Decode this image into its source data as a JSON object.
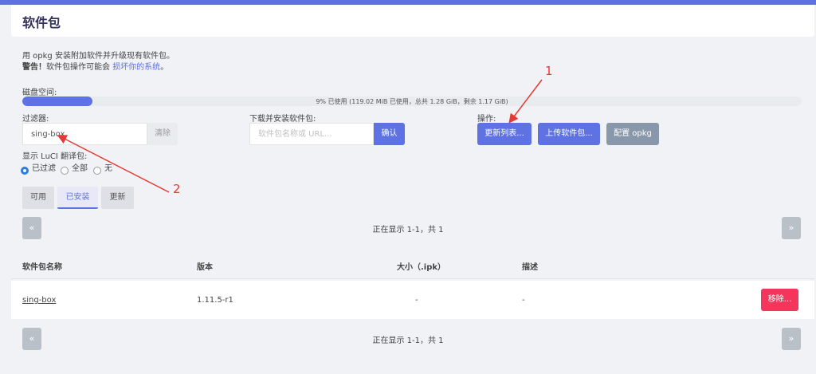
{
  "page": {
    "title": "软件包",
    "intro": "用 opkg 安装附加软件并升级现有软件包。",
    "warning_prefix": "警告！",
    "warning_text": "软件包操作可能会",
    "warning_link": "损坏你的系统",
    "warning_suffix": "。"
  },
  "disk": {
    "label": "磁盘空间:",
    "used_fraction": 0.09,
    "status_text": "9% 已使用 (119.02 MiB 已使用，总共 1.28 GiB，剩余 1.17 GiB)"
  },
  "filter": {
    "label": "过滤器:",
    "value": "sing-box",
    "clear_label": "清除"
  },
  "download": {
    "label": "下载并安装软件包:",
    "placeholder": "软件包名称或 URL...",
    "confirm_label": "确认"
  },
  "actions": {
    "label": "操作:",
    "update_label": "更新列表...",
    "upload_label": "上传软件包...",
    "config_label": "配置 opkg"
  },
  "luci": {
    "label": "显示 LuCI 翻译包:",
    "options": [
      "已过滤",
      "全部",
      "无"
    ],
    "selected": 0
  },
  "tabs": [
    "可用",
    "已安装",
    "更新"
  ],
  "active_tab": 1,
  "pagination": {
    "prev": "«",
    "next": "»",
    "status": "正在显示 1-1，共 1"
  },
  "table": {
    "headers": [
      "软件包名称",
      "版本",
      "大小（.ipk）",
      "描述"
    ],
    "rows": [
      {
        "name": "sing-box",
        "version": "1.11.5-r1",
        "size": "-",
        "desc": "-",
        "action": "移除..."
      }
    ]
  },
  "annotations": [
    "1",
    "2"
  ],
  "colors": {
    "accent": "#5e72e4",
    "danger": "#f5365c",
    "annotation": "#e53935"
  }
}
